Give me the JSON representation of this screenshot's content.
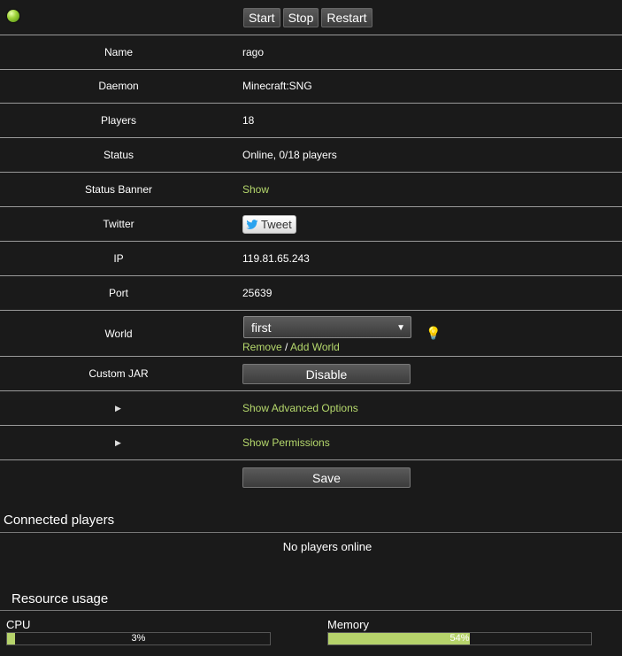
{
  "controls": {
    "start": "Start",
    "stop": "Stop",
    "restart": "Restart"
  },
  "fields": {
    "name_label": "Name",
    "name_value": "rago",
    "daemon_label": "Daemon",
    "daemon_value": "Minecraft:SNG",
    "players_label": "Players",
    "players_value": "18",
    "status_label": "Status",
    "status_value": "Online, 0/18 players",
    "banner_label": "Status Banner",
    "banner_link": "Show",
    "twitter_label": "Twitter",
    "tweet_button": "Tweet",
    "ip_label": "IP",
    "ip_value": "119.81.65.243",
    "port_label": "Port",
    "port_value": "25639",
    "world_label": "World",
    "world_selected": "first",
    "world_remove": "Remove",
    "world_sep": "/",
    "world_add": "Add World",
    "jar_label": "Custom JAR",
    "jar_button": "Disable",
    "advanced_link": "Show Advanced Options",
    "permissions_link": "Show Permissions",
    "save_button": "Save"
  },
  "connected": {
    "title": "Connected players",
    "empty": "No players online"
  },
  "resources": {
    "title": "Resource usage",
    "cpu_label": "CPU",
    "cpu_text": "3%",
    "cpu_value": 3,
    "memory_label": "Memory",
    "memory_text": "54%",
    "memory_value": 54
  },
  "colors": {
    "accent": "#b6d36b",
    "status_online": "#9fd33a"
  },
  "icons": {
    "status": "status-online-icon",
    "world_hint": "lightbulb-icon",
    "twitter": "twitter-bird-icon"
  }
}
